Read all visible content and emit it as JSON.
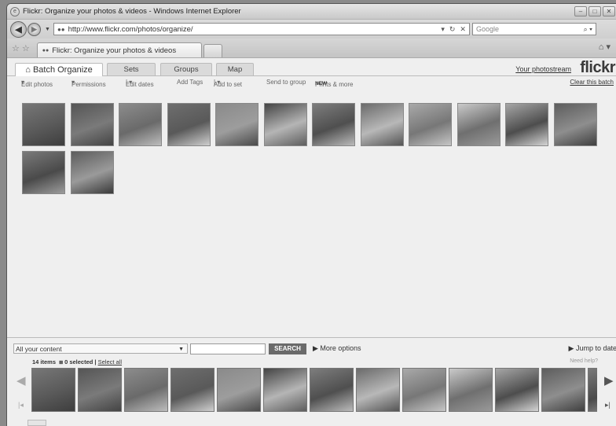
{
  "browser": {
    "title": "Flickr: Organize your photos & videos - Windows Internet Explorer",
    "url": "http://www.flickr.com/photos/organize/",
    "search_placeholder": "Google",
    "tab_title": "Flickr: Organize your photos & videos"
  },
  "page": {
    "tabs": [
      {
        "label": "Batch Organize",
        "active": true
      },
      {
        "label": "Sets"
      },
      {
        "label": "Groups"
      },
      {
        "label": "Map"
      }
    ],
    "photostream_link": "Your photostream",
    "logo": "flickr",
    "toolbar": {
      "edit_photos": "Edit photos",
      "permissions": "Permissions",
      "edit_dates": "Edit dates",
      "add_tags": "Add Tags",
      "add_to_set": "Add to set",
      "send_to_group": "Send to group",
      "new_badge": "NEW",
      "prints": "Prints & more",
      "clear_batch": "Clear this batch"
    },
    "batch_photos": [
      {
        "colors": [
          "#777",
          "#5a5a5a",
          "#3e3e3e"
        ]
      },
      {
        "colors": [
          "#555",
          "#7a7a7a",
          "#444"
        ]
      },
      {
        "colors": [
          "#8c8c8c",
          "#6a6a6a",
          "#bdbdbd"
        ]
      },
      {
        "colors": [
          "#6e6e6e",
          "#595959",
          "#cfcfcf"
        ]
      },
      {
        "colors": [
          "#8a8a8a",
          "#9d9d9d",
          "#4a4a4a"
        ]
      },
      {
        "colors": [
          "#444",
          "#b5b5b5",
          "#5e5e5e"
        ]
      },
      {
        "colors": [
          "#7d7d7d",
          "#4f4f4f",
          "#bbb"
        ]
      },
      {
        "colors": [
          "#6b6b6b",
          "#b8b8b8",
          "#555"
        ]
      },
      {
        "colors": [
          "#a9a9a9",
          "#777",
          "#c6c6c6"
        ]
      },
      {
        "colors": [
          "#cacaca",
          "#6f6f6f",
          "#999"
        ]
      },
      {
        "colors": [
          "#a6a6a6",
          "#4d4d4d",
          "#d4d4d4"
        ]
      },
      {
        "colors": [
          "#5d5d5d",
          "#8e8e8e",
          "#3f3f3f"
        ]
      },
      {
        "colors": [
          "#7a7a7a",
          "#4a4a4a",
          "#9c9c9c"
        ]
      },
      {
        "colors": [
          "#5c5c5c",
          "#9a9a9a",
          "#3a3a3a"
        ]
      }
    ],
    "search": {
      "filter_value": "All your content",
      "button_label": "SEARCH",
      "more_options": "More options",
      "jump_to_date": "Jump to date"
    },
    "strip": {
      "count_text": "14 items",
      "selected_text": "0 selected",
      "select_all": "Select all",
      "need_help": "Need help?"
    }
  }
}
